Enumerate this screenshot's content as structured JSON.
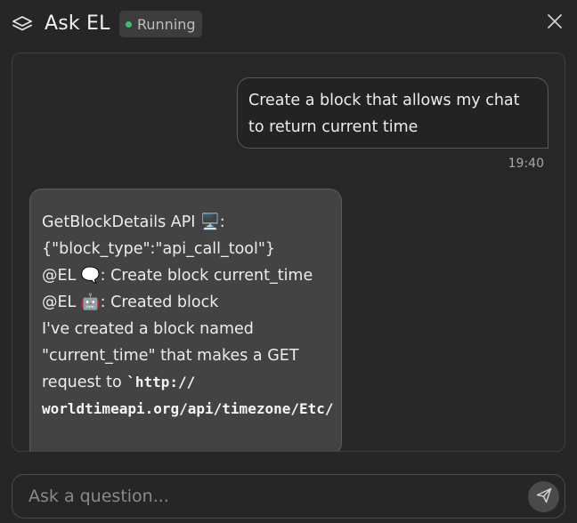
{
  "header": {
    "title": "Ask EL",
    "status": "Running",
    "logo_icon": "layers-icon",
    "close_icon": "close-icon"
  },
  "colors": {
    "background": "#262626",
    "status_dot": "#35c46a",
    "assistant_bubble": "#434343"
  },
  "messages": {
    "user": {
      "text": "Create a block that allows my chat to return current time",
      "time": "19:40"
    },
    "assistant": {
      "lines": [
        "GetBlockDetails API 🖥️:",
        "{\"block_type\":\"api_call_tool\"}",
        "@EL 🗨️: Create block current_time",
        "@EL 🤖: Created block",
        "I've created a block named",
        "\"current_time\" that makes a GET"
      ],
      "request_prefix": "request to ",
      "code_part1": "`http://",
      "code_part2": "worldtimeapi.org/api/timezone/Etc/"
    }
  },
  "input": {
    "placeholder": "Ask a question...",
    "value": "",
    "send_icon": "send-icon"
  }
}
